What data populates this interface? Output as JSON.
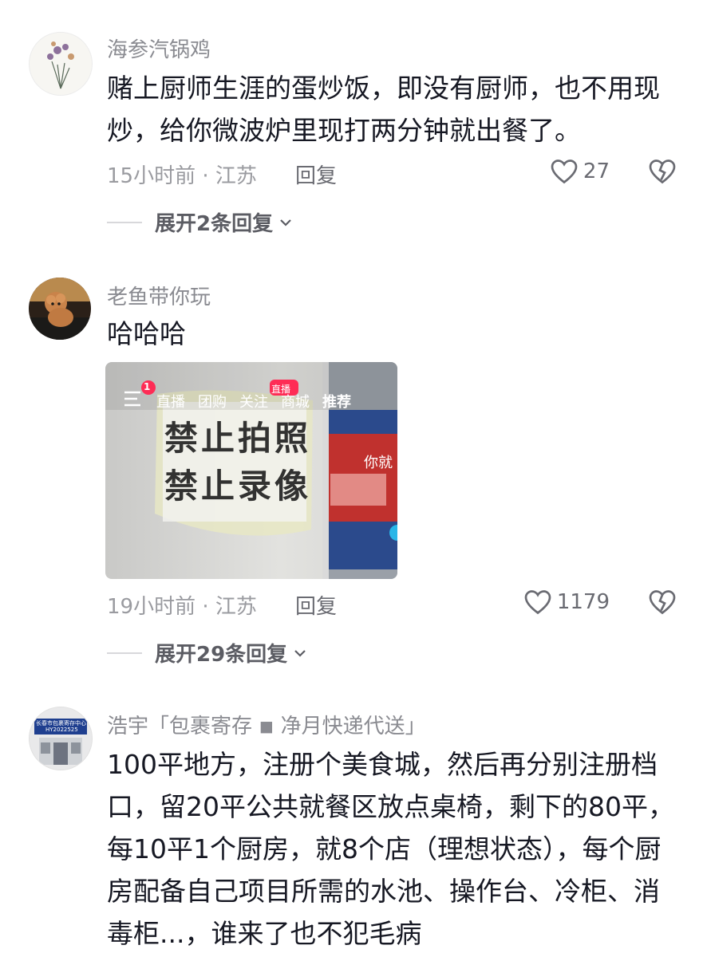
{
  "comments": [
    {
      "username": "海参汽锅鸡",
      "text": "赌上厨师生涯的蛋炒饭，即没有厨师，也不用现炒，给你微波炉里现打两分钟就出餐了。",
      "meta": "15小时前 · 江苏",
      "reply_label": "回复",
      "likes": "27",
      "expand_label": "展开2条回复"
    },
    {
      "username": "老鱼带你玩",
      "text": "哈哈哈",
      "meta": "19小时前 · 江苏",
      "reply_label": "回复",
      "likes": "1179",
      "expand_label": "展开29条回复",
      "image": {
        "tabs": [
          "直播",
          "团购",
          "关注",
          "商城",
          "推荐"
        ],
        "badge_count": "1",
        "live_badge": "直播",
        "sign_line1": "禁止拍照",
        "sign_line2": "禁止录像",
        "screen_text": "你就"
      }
    },
    {
      "username": "浩宇「包裹寄存 ◾ 净月快递代送」",
      "avatar_text_1": "长春市包裹寄存中心",
      "avatar_text_2": "HY2022525",
      "text": "100平地方，注册个美食城，然后再分别注册档口，留20平公共就餐区放点桌椅，剩下的80平，每10平1个厨房，就8个店（理想状态），每个厨房配备自己项目所需的水池、操作台、冷柜、消毒柜...，谁来了也不犯毛病"
    }
  ],
  "colors": {
    "text_primary": "#161823",
    "text_secondary": "#8a8b91",
    "badge_red": "#fe2c55"
  }
}
